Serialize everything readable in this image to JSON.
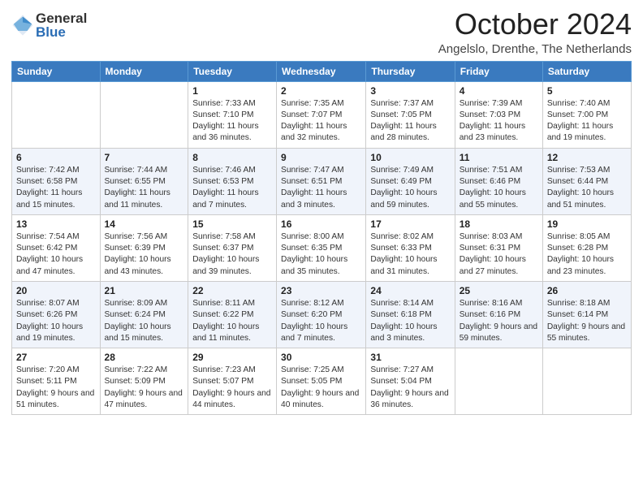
{
  "header": {
    "logo": {
      "general": "General",
      "blue": "Blue"
    },
    "title": "October 2024",
    "location": "Angelslo, Drenthe, The Netherlands"
  },
  "calendar": {
    "days_of_week": [
      "Sunday",
      "Monday",
      "Tuesday",
      "Wednesday",
      "Thursday",
      "Friday",
      "Saturday"
    ],
    "weeks": [
      {
        "days": [
          {
            "number": "",
            "info": ""
          },
          {
            "number": "",
            "info": ""
          },
          {
            "number": "1",
            "info": "Sunrise: 7:33 AM\nSunset: 7:10 PM\nDaylight: 11 hours and 36 minutes."
          },
          {
            "number": "2",
            "info": "Sunrise: 7:35 AM\nSunset: 7:07 PM\nDaylight: 11 hours and 32 minutes."
          },
          {
            "number": "3",
            "info": "Sunrise: 7:37 AM\nSunset: 7:05 PM\nDaylight: 11 hours and 28 minutes."
          },
          {
            "number": "4",
            "info": "Sunrise: 7:39 AM\nSunset: 7:03 PM\nDaylight: 11 hours and 23 minutes."
          },
          {
            "number": "5",
            "info": "Sunrise: 7:40 AM\nSunset: 7:00 PM\nDaylight: 11 hours and 19 minutes."
          }
        ]
      },
      {
        "days": [
          {
            "number": "6",
            "info": "Sunrise: 7:42 AM\nSunset: 6:58 PM\nDaylight: 11 hours and 15 minutes."
          },
          {
            "number": "7",
            "info": "Sunrise: 7:44 AM\nSunset: 6:55 PM\nDaylight: 11 hours and 11 minutes."
          },
          {
            "number": "8",
            "info": "Sunrise: 7:46 AM\nSunset: 6:53 PM\nDaylight: 11 hours and 7 minutes."
          },
          {
            "number": "9",
            "info": "Sunrise: 7:47 AM\nSunset: 6:51 PM\nDaylight: 11 hours and 3 minutes."
          },
          {
            "number": "10",
            "info": "Sunrise: 7:49 AM\nSunset: 6:49 PM\nDaylight: 10 hours and 59 minutes."
          },
          {
            "number": "11",
            "info": "Sunrise: 7:51 AM\nSunset: 6:46 PM\nDaylight: 10 hours and 55 minutes."
          },
          {
            "number": "12",
            "info": "Sunrise: 7:53 AM\nSunset: 6:44 PM\nDaylight: 10 hours and 51 minutes."
          }
        ]
      },
      {
        "days": [
          {
            "number": "13",
            "info": "Sunrise: 7:54 AM\nSunset: 6:42 PM\nDaylight: 10 hours and 47 minutes."
          },
          {
            "number": "14",
            "info": "Sunrise: 7:56 AM\nSunset: 6:39 PM\nDaylight: 10 hours and 43 minutes."
          },
          {
            "number": "15",
            "info": "Sunrise: 7:58 AM\nSunset: 6:37 PM\nDaylight: 10 hours and 39 minutes."
          },
          {
            "number": "16",
            "info": "Sunrise: 8:00 AM\nSunset: 6:35 PM\nDaylight: 10 hours and 35 minutes."
          },
          {
            "number": "17",
            "info": "Sunrise: 8:02 AM\nSunset: 6:33 PM\nDaylight: 10 hours and 31 minutes."
          },
          {
            "number": "18",
            "info": "Sunrise: 8:03 AM\nSunset: 6:31 PM\nDaylight: 10 hours and 27 minutes."
          },
          {
            "number": "19",
            "info": "Sunrise: 8:05 AM\nSunset: 6:28 PM\nDaylight: 10 hours and 23 minutes."
          }
        ]
      },
      {
        "days": [
          {
            "number": "20",
            "info": "Sunrise: 8:07 AM\nSunset: 6:26 PM\nDaylight: 10 hours and 19 minutes."
          },
          {
            "number": "21",
            "info": "Sunrise: 8:09 AM\nSunset: 6:24 PM\nDaylight: 10 hours and 15 minutes."
          },
          {
            "number": "22",
            "info": "Sunrise: 8:11 AM\nSunset: 6:22 PM\nDaylight: 10 hours and 11 minutes."
          },
          {
            "number": "23",
            "info": "Sunrise: 8:12 AM\nSunset: 6:20 PM\nDaylight: 10 hours and 7 minutes."
          },
          {
            "number": "24",
            "info": "Sunrise: 8:14 AM\nSunset: 6:18 PM\nDaylight: 10 hours and 3 minutes."
          },
          {
            "number": "25",
            "info": "Sunrise: 8:16 AM\nSunset: 6:16 PM\nDaylight: 9 hours and 59 minutes."
          },
          {
            "number": "26",
            "info": "Sunrise: 8:18 AM\nSunset: 6:14 PM\nDaylight: 9 hours and 55 minutes."
          }
        ]
      },
      {
        "days": [
          {
            "number": "27",
            "info": "Sunrise: 7:20 AM\nSunset: 5:11 PM\nDaylight: 9 hours and 51 minutes."
          },
          {
            "number": "28",
            "info": "Sunrise: 7:22 AM\nSunset: 5:09 PM\nDaylight: 9 hours and 47 minutes."
          },
          {
            "number": "29",
            "info": "Sunrise: 7:23 AM\nSunset: 5:07 PM\nDaylight: 9 hours and 44 minutes."
          },
          {
            "number": "30",
            "info": "Sunrise: 7:25 AM\nSunset: 5:05 PM\nDaylight: 9 hours and 40 minutes."
          },
          {
            "number": "31",
            "info": "Sunrise: 7:27 AM\nSunset: 5:04 PM\nDaylight: 9 hours and 36 minutes."
          },
          {
            "number": "",
            "info": ""
          },
          {
            "number": "",
            "info": ""
          }
        ]
      }
    ]
  }
}
